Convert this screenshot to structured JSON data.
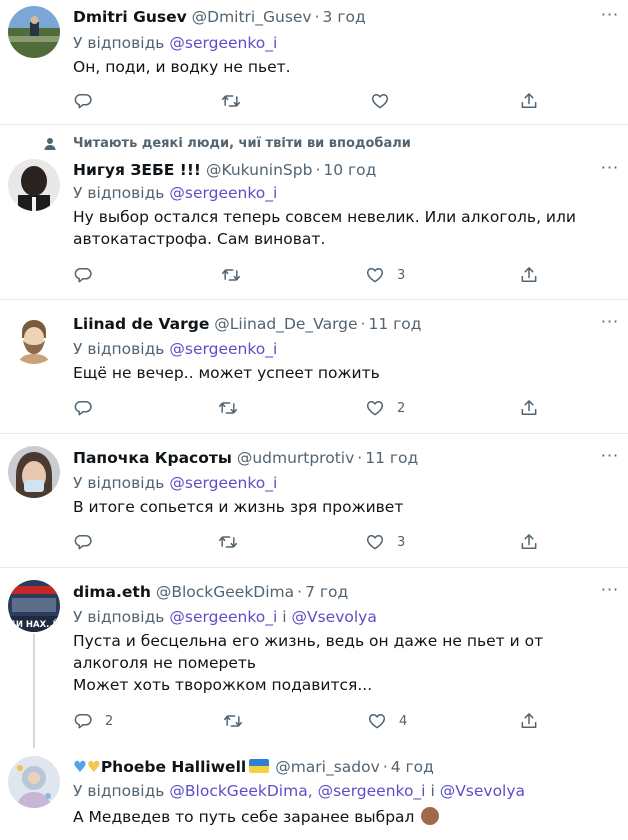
{
  "tweets": [
    {
      "name": "Dmitri Gusev",
      "handle": "@Dmitri_Gusev",
      "time": "3 год",
      "reply_prefix": "У відповідь",
      "reply_to": "@sergeenko_i",
      "text": "Он, поди, и водку не пьет.",
      "likes": "",
      "replies": ""
    },
    {
      "social_context": "Читають деякі люди, чиї твіти ви вподобали",
      "name": "Нигуя ЗЕБЕ !!!",
      "handle": "@KukuninSpb",
      "time": "10 год",
      "reply_prefix": "У відповідь",
      "reply_to": "@sergeenko_i",
      "text": "Ну выбор остался теперь совсем невелик. Или алкоголь, или автокатастрофа. Сам виноват.",
      "likes": "3",
      "replies": ""
    },
    {
      "name": "Liinad de Varge",
      "handle": "@Liinad_De_Varge",
      "time": "11 год",
      "reply_prefix": "У відповідь",
      "reply_to": "@sergeenko_i",
      "text": "Ещё не вечер.. может успеет пожить",
      "likes": "2",
      "replies": ""
    },
    {
      "name": "Папочка Красоты",
      "handle": "@udmurtprotiv",
      "time": "11 год",
      "reply_prefix": "У відповідь",
      "reply_to": "@sergeenko_i",
      "text": "В итоге сопьется и жизнь зря проживет",
      "likes": "3",
      "replies": ""
    },
    {
      "name": "dima.eth",
      "handle": "@BlockGeekDima",
      "time": "7 год",
      "reply_prefix": "У відповідь",
      "reply_to": "@sergeenko_i",
      "reply_joiner": "і",
      "reply_to2": "@Vsevolya",
      "text": "Пуста и бесцельна его жизнь, ведь он даже не пьет и от алкоголя не помереть",
      "text2": "Может хоть творожком подавится...",
      "likes": "4",
      "replies": "2",
      "avatar_text": "ДИ НАХ..Й"
    },
    {
      "name": "Phoebe Halliwell",
      "handle": "@mari_sadov",
      "time": "4 год",
      "reply_prefix": "У відповідь",
      "reply_to": "@BlockGeekDima,",
      "reply_to2": "@sergeenko_i",
      "reply_joiner": "і",
      "reply_to3": "@Vsevolya",
      "text": "А Медведев то путь себе заранее выбрал",
      "likes": "",
      "replies": ""
    }
  ],
  "more_glyph": "···",
  "colors": {
    "link": "#5b4fc9",
    "muted": "#536471",
    "divider": "#e4e9ed"
  },
  "icons": [
    "reply-icon",
    "retweet-icon",
    "like-icon",
    "share-icon",
    "more-icon",
    "person-icon"
  ]
}
